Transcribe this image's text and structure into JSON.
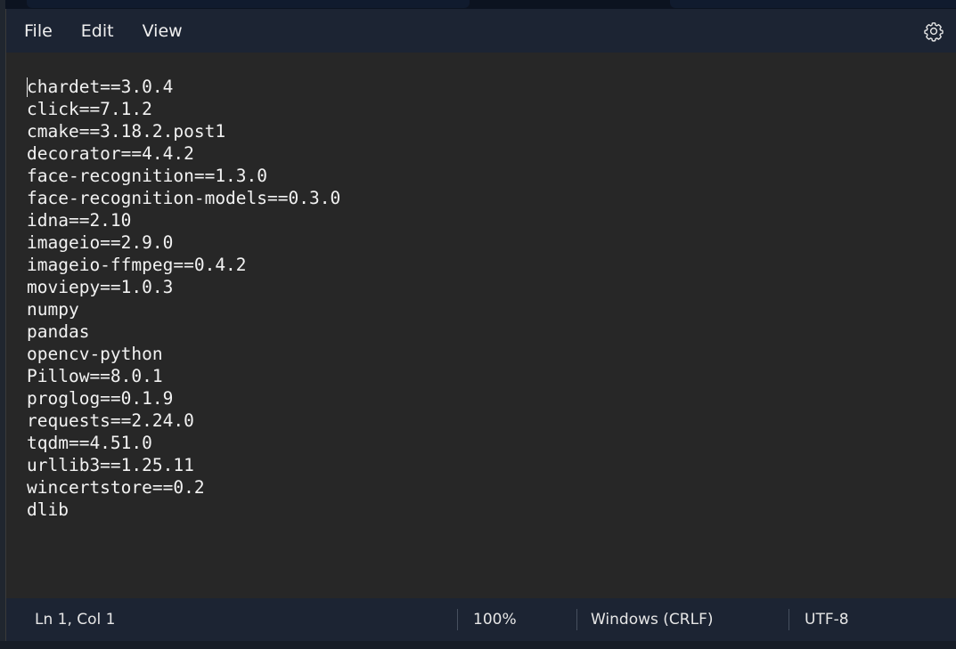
{
  "menu": {
    "file": "File",
    "edit": "Edit",
    "view": "View"
  },
  "icons": {
    "settings": "gear-icon"
  },
  "editor": {
    "lines": [
      "chardet==3.0.4",
      "click==7.1.2",
      "cmake==3.18.2.post1",
      "decorator==4.4.2",
      "face-recognition==1.3.0",
      "face-recognition-models==0.3.0",
      "idna==2.10",
      "imageio==2.9.0",
      "imageio-ffmpeg==0.4.2",
      "moviepy==1.0.3",
      "numpy",
      "pandas",
      "opencv-python",
      "Pillow==8.0.1",
      "proglog==0.1.9",
      "requests==2.24.0",
      "tqdm==4.51.0",
      "urllib3==1.25.11",
      "wincertstore==0.2",
      "dlib"
    ]
  },
  "status": {
    "position": "Ln 1, Col 1",
    "zoom": "100%",
    "line_ending": "Windows (CRLF)",
    "encoding": "UTF-8"
  },
  "colors": {
    "chrome": "#1c2433",
    "editor_bg": "#272727",
    "text": "#f2f2f2"
  }
}
